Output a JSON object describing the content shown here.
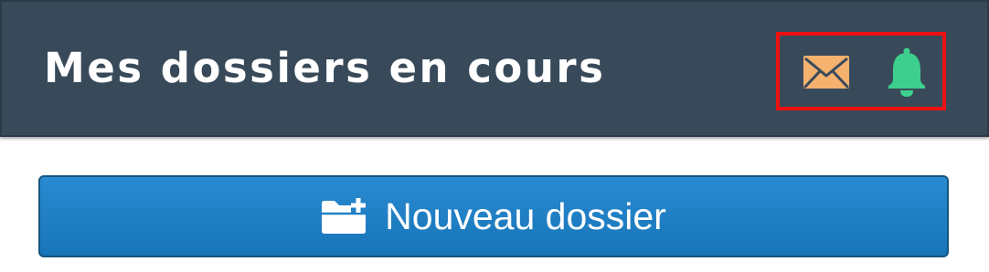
{
  "header": {
    "title": "Mes dossiers en cours",
    "icons": {
      "mail": "envelope-icon",
      "notifications": "bell-icon"
    }
  },
  "actions": {
    "new_folder_label": "Nouveau dossier",
    "new_folder_icon": "folder-plus-icon"
  },
  "colors": {
    "header_background": "#384a5a",
    "title_text": "#ffffff",
    "mail_icon": "#f5b26e",
    "bell_icon": "#3ecf8e",
    "highlight_border": "#ee1111",
    "button_background": "#1f80c4",
    "button_border": "#16557f"
  }
}
